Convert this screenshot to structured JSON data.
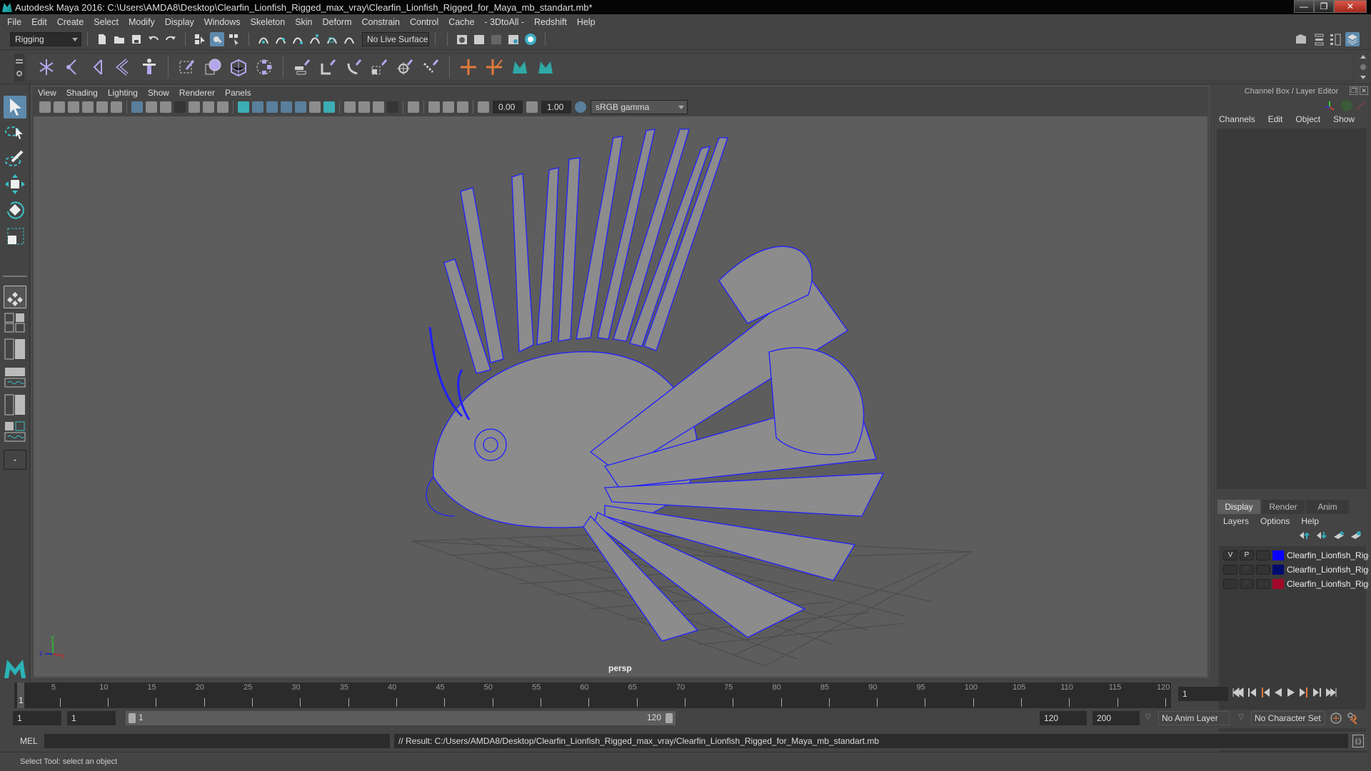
{
  "window": {
    "title": "Autodesk Maya 2016: C:\\Users\\AMDA8\\Desktop\\Clearfin_Lionfish_Rigged_max_vray\\Clearfin_Lionfish_Rigged_for_Maya_mb_standart.mb*",
    "minimize": "—",
    "restore": "❐",
    "close": "✕"
  },
  "menubar": [
    "File",
    "Edit",
    "Create",
    "Select",
    "Modify",
    "Display",
    "Windows",
    "Skeleton",
    "Skin",
    "Deform",
    "Constrain",
    "Control",
    "Cache",
    "- 3DtoAll -",
    "Redshift",
    "Help"
  ],
  "statusline": {
    "menuset": "Rigging",
    "live_surface": "No Live Surface"
  },
  "viewport_panel": {
    "menu": [
      "View",
      "Shading",
      "Lighting",
      "Show",
      "Renderer",
      "Panels"
    ],
    "exposure": "0.00",
    "gamma": "1.00",
    "color_space": "sRGB gamma",
    "camera": "persp",
    "axis": {
      "x": "x",
      "y": "y",
      "z": "z"
    }
  },
  "channel_box": {
    "header": "Channel Box / Layer Editor",
    "menu": [
      "Channels",
      "Edit",
      "Object",
      "Show"
    ]
  },
  "layer_editor": {
    "tabs": [
      "Display",
      "Render",
      "Anim"
    ],
    "active_tab": "Display",
    "menu": [
      "Layers",
      "Options",
      "Help"
    ],
    "layers": [
      {
        "v": "V",
        "p": "P",
        "color": "#0a00ff",
        "name": "Clearfin_Lionfish_Rigg"
      },
      {
        "v": "",
        "p": "P",
        "color": "#000a6e",
        "name": "Clearfin_Lionfish_Rigg"
      },
      {
        "v": "",
        "p": "P",
        "color": "#a00a28",
        "name": "Clearfin_Lionfish_Rigg"
      }
    ]
  },
  "timeline": {
    "ticks": [
      "5",
      "10",
      "15",
      "20",
      "25",
      "30",
      "35",
      "40",
      "45",
      "50",
      "55",
      "60",
      "65",
      "70",
      "75",
      "80",
      "85",
      "90",
      "95",
      "100",
      "105",
      "110",
      "115",
      "120"
    ],
    "current_frame_marker": "1",
    "current_frame": "1"
  },
  "range": {
    "start": "1",
    "playback_start": "1",
    "slider_start": "1",
    "slider_end": "120",
    "playback_end": "120",
    "end": "200",
    "anim_layer": "No Anim Layer",
    "character_set": "No Character Set"
  },
  "command": {
    "language": "MEL",
    "input": "",
    "result": "// Result: C:/Users/AMDA8/Desktop/Clearfin_Lionfish_Rigged_max_vray/Clearfin_Lionfish_Rigged_for_Maya_mb_standart.mb"
  },
  "help_line": "Select Tool: select an object",
  "colors": {
    "accent": "#5d8aad",
    "teal": "#3cc0c8",
    "wire": "#2020ff",
    "orange": "#e07a3a"
  }
}
